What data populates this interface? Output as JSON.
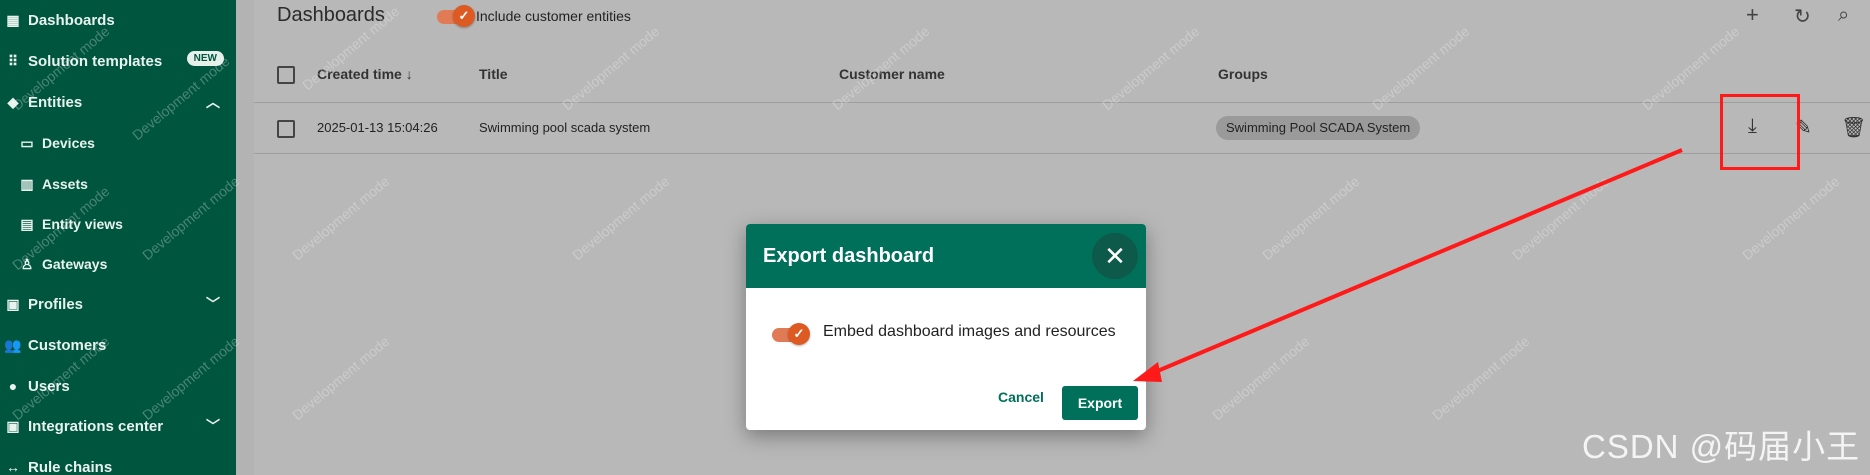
{
  "sidebar": {
    "items": [
      {
        "label": "Dashboards",
        "icon": "grid-icon"
      },
      {
        "label": "Solution templates",
        "icon": "apps-icon",
        "badge": "NEW"
      },
      {
        "label": "Entities",
        "icon": "entities-icon"
      },
      {
        "label": "Devices",
        "icon": "devices-icon"
      },
      {
        "label": "Assets",
        "icon": "assets-icon"
      },
      {
        "label": "Entity views",
        "icon": "entity-views-icon"
      },
      {
        "label": "Gateways",
        "icon": "gateway-icon"
      },
      {
        "label": "Profiles",
        "icon": "profiles-icon"
      },
      {
        "label": "Customers",
        "icon": "customers-icon"
      },
      {
        "label": "Users",
        "icon": "users-icon"
      },
      {
        "label": "Integrations center",
        "icon": "integrations-icon"
      },
      {
        "label": "Rule chains",
        "icon": "rule-chains-icon"
      }
    ]
  },
  "header": {
    "title": "Dashboards",
    "include_customer_entities": "Include customer entities"
  },
  "table": {
    "columns": [
      "Created time",
      "Title",
      "Customer name",
      "Groups"
    ],
    "rows": [
      {
        "created": "2025-01-13 15:04:26",
        "title": "Swimming pool scada system",
        "customer": "",
        "group": "Swimming Pool SCADA System"
      }
    ]
  },
  "dialog": {
    "title": "Export dashboard",
    "embed_label": "Embed dashboard images and resources",
    "cancel": "Cancel",
    "export": "Export"
  },
  "watermark": "Development mode",
  "footer_mark": "CSDN @码届小王",
  "colors": {
    "sidebar": "#00553f",
    "primary": "#00705a",
    "toggle": "#dd5a23",
    "highlight": "#ff1a1a"
  }
}
